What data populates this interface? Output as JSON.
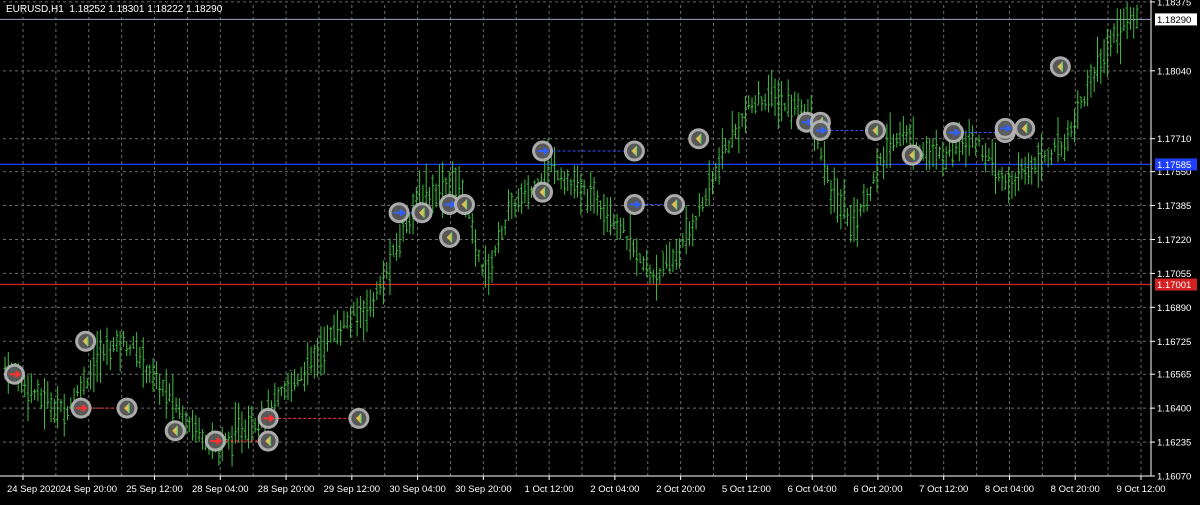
{
  "header": {
    "symbol_tf": "EURUSD,H1",
    "ohlc": "1.18252 1.18301 1.18222 1.18290"
  },
  "colors": {
    "background": "#000000",
    "grid": "#6a6a6a",
    "candle": "#3fbf3f",
    "axis": "#ffffff",
    "blue_line": "#1f3fff",
    "red_line": "#d42020",
    "price_line": "#9aa6c8",
    "marker_ring": "#b4b4b4",
    "marker_fill": "#5c5c5c",
    "marker_arrow_buy": "#3060ff",
    "marker_arrow_sell": "#ff3030",
    "marker_arrow_close": "#e0c050",
    "dash_buy": "#3050ff",
    "dash_sell": "#ff3030"
  },
  "chart_data": {
    "type": "candlestick",
    "y_range": [
      1.1607,
      1.1836
    ],
    "y_ticks": [
      "1.18375",
      "1.18290",
      "1.18040",
      "1.17710",
      "1.17550",
      "1.17385",
      "1.17220",
      "1.17055",
      "1.17001",
      "1.16890",
      "1.16725",
      "1.16565",
      "1.16400",
      "1.16235",
      "1.16070"
    ],
    "x_ticks": [
      "24 Sep 2020",
      "24 Sep 20:00",
      "25 Sep 12:00",
      "28 Sep 04:00",
      "28 Sep 20:00",
      "29 Sep 12:00",
      "30 Sep 04:00",
      "30 Sep 20:00",
      "1 Oct 12:00",
      "2 Oct 04:00",
      "2 Oct 20:00",
      "5 Oct 12:00",
      "6 Oct 04:00",
      "6 Oct 20:00",
      "7 Oct 12:00",
      "8 Oct 04:00",
      "8 Oct 20:00",
      "9 Oct 12:00"
    ],
    "current_price": 1.1829,
    "current_price_label": "1.18290",
    "horizontal_lines": [
      {
        "price": 1.17585,
        "label": "1.17585",
        "color": "#1f3fff"
      },
      {
        "price": 1.17001,
        "label": "1.17001",
        "color": "#d42020"
      }
    ],
    "price_path": [
      1.166,
      1.1656,
      1.165,
      1.1645,
      1.1642,
      1.1638,
      1.1646,
      1.1655,
      1.1665,
      1.167,
      1.1672,
      1.1669,
      1.166,
      1.1652,
      1.1645,
      1.1638,
      1.1632,
      1.1626,
      1.1622,
      1.1624,
      1.163,
      1.1633,
      1.1638,
      1.1642,
      1.165,
      1.1656,
      1.1662,
      1.167,
      1.1678,
      1.1682,
      1.1686,
      1.169,
      1.17,
      1.1715,
      1.173,
      1.1742,
      1.1745,
      1.1748,
      1.175,
      1.1742,
      1.1715,
      1.1705,
      1.1725,
      1.1738,
      1.1742,
      1.1748,
      1.176,
      1.1755,
      1.1748,
      1.1745,
      1.1742,
      1.1738,
      1.173,
      1.172,
      1.171,
      1.1705,
      1.1708,
      1.1715,
      1.1725,
      1.1738,
      1.175,
      1.1765,
      1.1775,
      1.1785,
      1.179,
      1.1792,
      1.1788,
      1.1786,
      1.1785,
      1.177,
      1.1745,
      1.1738,
      1.173,
      1.1742,
      1.1755,
      1.1768,
      1.1775,
      1.177,
      1.1765,
      1.1762,
      1.1765,
      1.177,
      1.1772,
      1.1765,
      1.1755,
      1.1748,
      1.1752,
      1.1758,
      1.1762,
      1.1765,
      1.177,
      1.1785,
      1.1798,
      1.181,
      1.182,
      1.1828,
      1.1829
    ],
    "trades": [
      {
        "open": [
          0.01,
          1.16565
        ],
        "close": null,
        "dir": "sell"
      },
      {
        "open": [
          0.068,
          1.164
        ],
        "close": [
          0.108,
          1.164
        ],
        "dir": "sell"
      },
      {
        "open": [
          0.072,
          1.16725
        ],
        "close": null,
        "dir": "close"
      },
      {
        "open": [
          0.15,
          1.1629
        ],
        "close": null,
        "dir": "close"
      },
      {
        "open": [
          0.185,
          1.1624
        ],
        "close": [
          0.231,
          1.1624
        ],
        "dir": "sell"
      },
      {
        "open": [
          0.231,
          1.1635
        ],
        "close": [
          0.31,
          1.1635
        ],
        "dir": "sell"
      },
      {
        "open": [
          0.345,
          1.1735
        ],
        "close": [
          0.365,
          1.1735
        ],
        "dir": "buy"
      },
      {
        "open": [
          0.389,
          1.1739
        ],
        "close": [
          0.402,
          1.1739
        ],
        "dir": "buy"
      },
      {
        "open": [
          0.389,
          1.1723
        ],
        "close": null,
        "dir": "close"
      },
      {
        "open": [
          0.47,
          1.1765
        ],
        "close": [
          0.55,
          1.1765
        ],
        "dir": "buy"
      },
      {
        "open": [
          0.47,
          1.1745
        ],
        "close": null,
        "dir": "close"
      },
      {
        "open": [
          0.55,
          1.1739
        ],
        "close": [
          0.585,
          1.1739
        ],
        "dir": "buy"
      },
      {
        "open": [
          0.606,
          1.1771
        ],
        "close": null,
        "dir": "close"
      },
      {
        "open": [
          0.7,
          1.1779
        ],
        "close": [
          0.712,
          1.1779
        ],
        "dir": "buy"
      },
      {
        "open": [
          0.712,
          1.1775
        ],
        "close": [
          0.76,
          1.1775
        ],
        "dir": "buy"
      },
      {
        "open": [
          0.792,
          1.1763
        ],
        "close": null,
        "dir": "close"
      },
      {
        "open": [
          0.828,
          1.1774
        ],
        "close": [
          0.873,
          1.1774
        ],
        "dir": "buy"
      },
      {
        "open": [
          0.873,
          1.1776
        ],
        "close": [
          0.89,
          1.1776
        ],
        "dir": "buy"
      },
      {
        "open": [
          0.921,
          1.1806
        ],
        "close": null,
        "dir": "close"
      }
    ]
  }
}
